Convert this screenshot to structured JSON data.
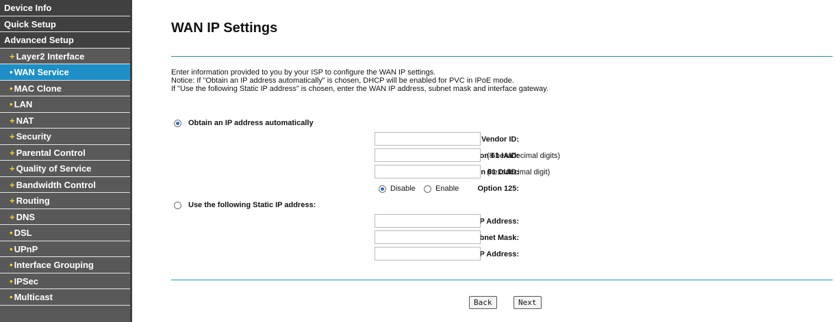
{
  "sidebar": {
    "items": [
      {
        "label": "Device Info",
        "type": "top"
      },
      {
        "label": "Quick Setup",
        "type": "top"
      },
      {
        "label": "Advanced Setup",
        "type": "top"
      },
      {
        "label": "Layer2 Interface",
        "type": "sub",
        "bullet": "+"
      },
      {
        "label": "WAN Service",
        "type": "sub",
        "bullet": "•",
        "active": true
      },
      {
        "label": "MAC Clone",
        "type": "sub",
        "bullet": "•"
      },
      {
        "label": "LAN",
        "type": "sub",
        "bullet": "•"
      },
      {
        "label": "NAT",
        "type": "sub",
        "bullet": "+"
      },
      {
        "label": "Security",
        "type": "sub",
        "bullet": "+"
      },
      {
        "label": "Parental Control",
        "type": "sub",
        "bullet": "+"
      },
      {
        "label": "Quality of Service",
        "type": "sub",
        "bullet": "+"
      },
      {
        "label": "Bandwidth Control",
        "type": "sub",
        "bullet": "+"
      },
      {
        "label": "Routing",
        "type": "sub",
        "bullet": "+"
      },
      {
        "label": "DNS",
        "type": "sub",
        "bullet": "+"
      },
      {
        "label": "DSL",
        "type": "sub",
        "bullet": "•"
      },
      {
        "label": "UPnP",
        "type": "sub",
        "bullet": "•"
      },
      {
        "label": "Interface Grouping",
        "type": "sub",
        "bullet": "•"
      },
      {
        "label": "IPSec",
        "type": "sub",
        "bullet": "•"
      },
      {
        "label": "Multicast",
        "type": "sub",
        "bullet": "•"
      }
    ]
  },
  "main": {
    "title": "WAN IP Settings",
    "description": [
      "Enter information provided to you by your ISP to configure the WAN IP settings.",
      "Notice: If \"Obtain an IP address automatically\" is chosen, DHCP will be enabled for PVC in IPoE mode.",
      "If \"Use the following Static IP address\" is chosen, enter the WAN IP address, subnet mask and interface gateway."
    ],
    "auto": {
      "label": "Obtain an IP address automatically",
      "selected": true,
      "option60_label": "Option 60 Vendor ID:",
      "option60_value": "",
      "option61_iaid_label": "Option 61 IAID:",
      "option61_iaid_value": "",
      "option61_iaid_hint": "(8 hexadecimal digits)",
      "option61_duid_label": "Option 61 DUID:",
      "option61_duid_value": "",
      "option61_duid_hint": "(hexadecimal digit)",
      "option125_label": "Option 125:",
      "option125_disable": "Disable",
      "option125_enable": "Enable",
      "option125_selected": "Disable"
    },
    "static": {
      "label": "Use the following Static IP address:",
      "selected": false,
      "wan_ip_label": "WAN IP Address:",
      "wan_ip_value": "",
      "subnet_label": "WAN Subnet Mask:",
      "subnet_value": "",
      "gateway_label": "WAN gateway IP Address:",
      "gateway_value": ""
    },
    "buttons": {
      "back": "Back",
      "next": "Next"
    }
  },
  "colors": {
    "sidebar_bg": "#595959",
    "sidebar_top_bg": "#404040",
    "active_bg": "#1d8fc6",
    "bullet": "#ffcc33",
    "divider": "#2a8ab0"
  }
}
